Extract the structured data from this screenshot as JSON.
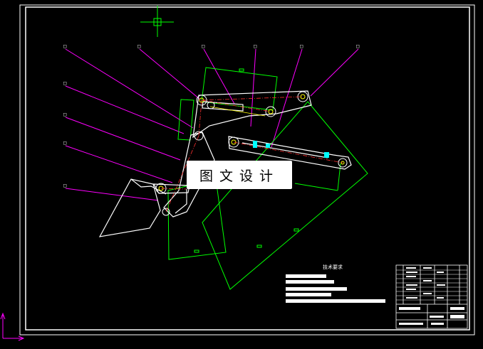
{
  "watermark": {
    "text": "图文设计"
  },
  "drawing": {
    "background": "#000000",
    "colors": {
      "frame": "#ffffff",
      "leader": "#ff00ff",
      "part": "#ffffff",
      "construction": "#00ff00",
      "dim": "#ffff00",
      "centerline": "#ff0000",
      "highlight": "#00ffff",
      "ucs": "#ff00ff"
    },
    "notes_title": "技术要求",
    "callout_marks": [
      "□",
      "□",
      "□",
      "□",
      "□",
      "□",
      "□",
      "□",
      "□",
      "□"
    ]
  }
}
